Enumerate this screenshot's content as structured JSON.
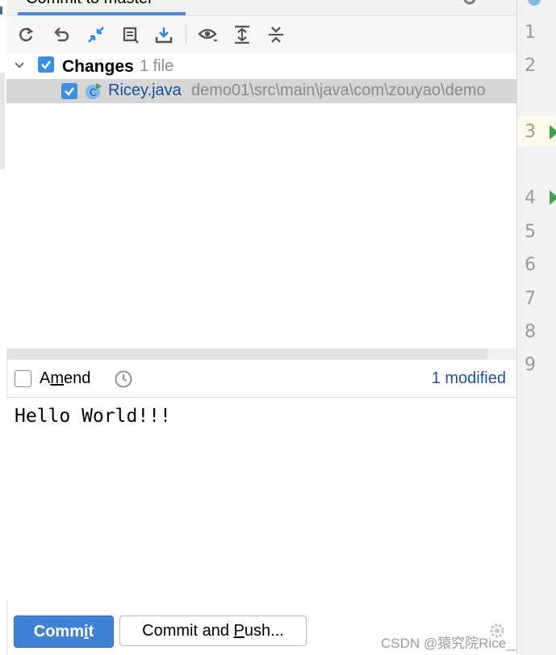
{
  "panel": {
    "tab_title": "Commit to master"
  },
  "toolbar": {
    "buttons": [
      "refresh",
      "rollback",
      "show-diff",
      "shelve",
      "download",
      "view-options",
      "expand-all",
      "collapse-all"
    ]
  },
  "changes": {
    "group_label": "Changes",
    "group_count": "1 file",
    "group_checked": true,
    "file": {
      "name": "Ricey.java",
      "path": "demo01\\src\\main\\java\\com\\zouyao\\demo",
      "checked": true,
      "icon": "java-class-icon"
    }
  },
  "amend": {
    "label_before": "A",
    "label_mnemonic": "m",
    "label_after": "end",
    "checked": false,
    "modified_text": "1 modified"
  },
  "message": {
    "text": "Hello World!!!"
  },
  "actions": {
    "commit_before": "Commit",
    "commit_mnemonic": "i",
    "commit_label_a": "Comm",
    "commit_label_b": "t",
    "push_label_a": "Commit and ",
    "push_mnemonic": "P",
    "push_label_b": "ush..."
  },
  "gutter": {
    "line_numbers": [
      "1",
      "2",
      "3",
      "4",
      "5",
      "6",
      "7",
      "8",
      "9"
    ]
  },
  "watermark": "CSDN @猿究院Rice__Y",
  "colors": {
    "accent": "#3f82d6",
    "link": "#1d4ea0",
    "run_marker": "#3fa34d"
  }
}
